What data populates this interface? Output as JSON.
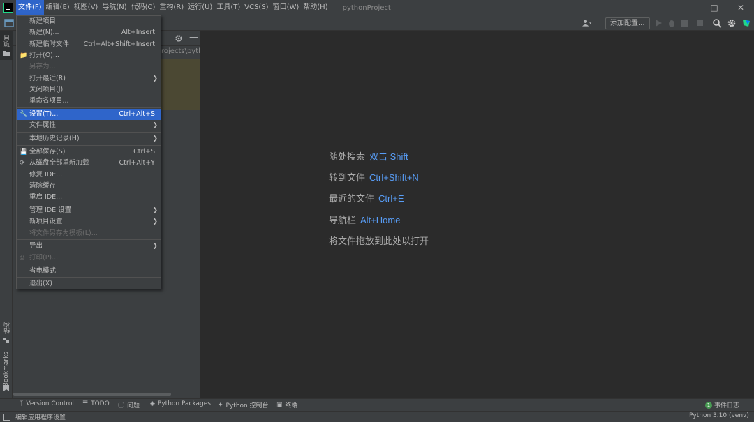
{
  "menubar": {
    "items": [
      "文件(F)",
      "编辑(E)",
      "视图(V)",
      "导航(N)",
      "代码(C)",
      "重构(R)",
      "运行(U)",
      "工具(T)",
      "VCS(S)",
      "窗口(W)",
      "帮助(H)"
    ],
    "project_title": "pythonProject"
  },
  "toolbar": {
    "add_config": "添加配置..."
  },
  "left_strip": {
    "project": "项目",
    "structure": "结构",
    "bookmarks": "Bookmarks"
  },
  "project_panel": {
    "path": "rojects\\pyth"
  },
  "file_menu": {
    "items": [
      {
        "label": "新建项目...",
        "shortcut": ""
      },
      {
        "label": "新建(N)...",
        "shortcut": "Alt+Insert"
      },
      {
        "label": "新建临时文件",
        "shortcut": "Ctrl+Alt+Shift+Insert"
      },
      {
        "label": "打开(O)...",
        "shortcut": ""
      },
      {
        "label": "另存为...",
        "shortcut": ""
      },
      {
        "label": "打开最近(R)",
        "shortcut": ""
      },
      {
        "label": "关闭项目(J)",
        "shortcut": ""
      },
      {
        "label": "重命名项目...",
        "shortcut": ""
      },
      {
        "label": "设置(T)...",
        "shortcut": "Ctrl+Alt+S"
      },
      {
        "label": "文件属性",
        "shortcut": ""
      },
      {
        "label": "本地历史记录(H)",
        "shortcut": ""
      },
      {
        "label": "全部保存(S)",
        "shortcut": "Ctrl+S"
      },
      {
        "label": "从磁盘全部重新加载",
        "shortcut": "Ctrl+Alt+Y"
      },
      {
        "label": "修复 IDE...",
        "shortcut": ""
      },
      {
        "label": "清除缓存...",
        "shortcut": ""
      },
      {
        "label": "重启 IDE...",
        "shortcut": ""
      },
      {
        "label": "管理 IDE 设置",
        "shortcut": ""
      },
      {
        "label": "新项目设置",
        "shortcut": ""
      },
      {
        "label": "将文件另存为模板(L)...",
        "shortcut": ""
      },
      {
        "label": "导出",
        "shortcut": ""
      },
      {
        "label": "打印(P)...",
        "shortcut": ""
      },
      {
        "label": "省电模式",
        "shortcut": ""
      },
      {
        "label": "退出(X)",
        "shortcut": ""
      }
    ]
  },
  "editor_hints": [
    {
      "text": "随处搜索",
      "key": "双击 Shift"
    },
    {
      "text": "转到文件",
      "key": "Ctrl+Shift+N"
    },
    {
      "text": "最近的文件",
      "key": "Ctrl+E"
    },
    {
      "text": "导航栏",
      "key": "Alt+Home"
    },
    {
      "text": "将文件拖放到此处以打开",
      "key": ""
    }
  ],
  "tool_tabs": {
    "version_control": "Version Control",
    "todo": "TODO",
    "problems": "问题",
    "python_packages": "Python Packages",
    "python_console": "Python 控制台",
    "terminal": "终端",
    "event_log": "事件日志",
    "event_count": "1"
  },
  "status": {
    "message": "编辑应用程序设置",
    "interpreter": "Python 3.10 (venv)"
  },
  "colors": {
    "accent": "#2f65ca",
    "link_key": "#589df6",
    "background": "#2b2b2b",
    "panel": "#3c3f41"
  }
}
